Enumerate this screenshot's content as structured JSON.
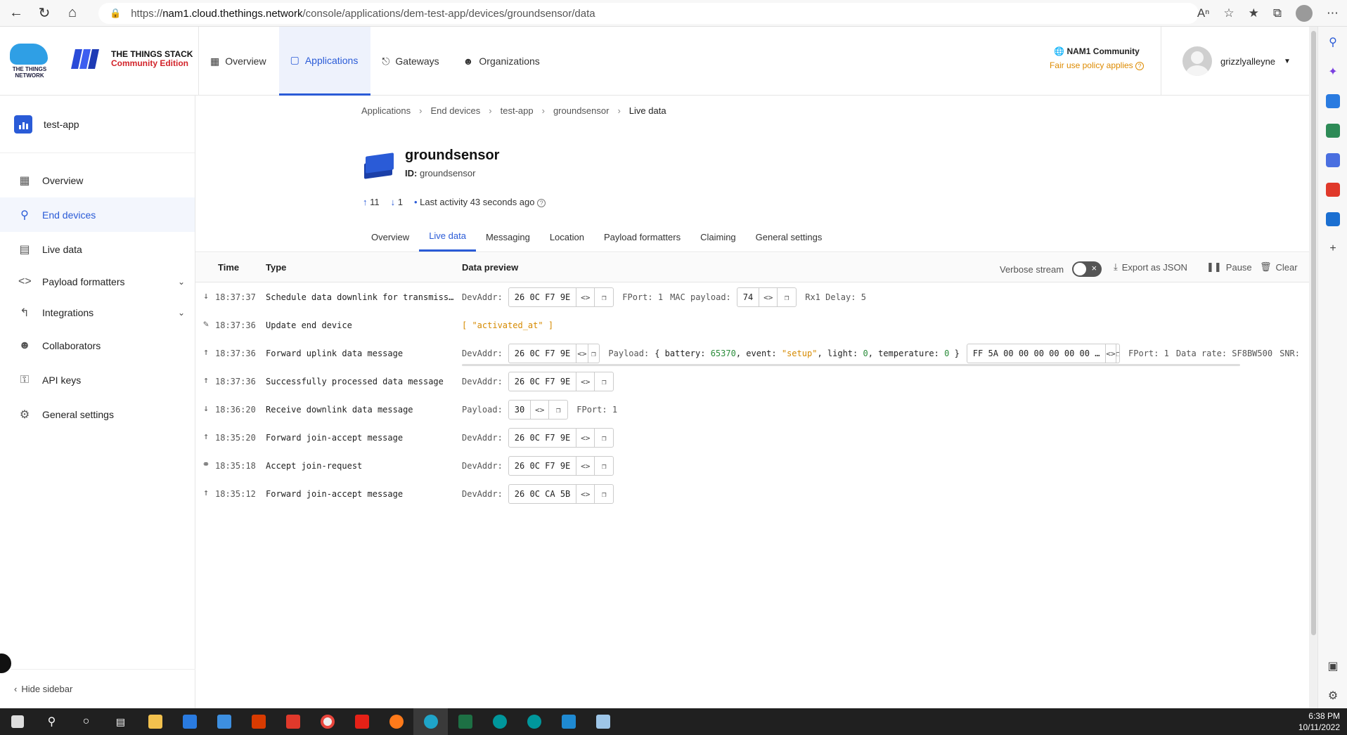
{
  "browser": {
    "url_prefix": "https://",
    "url_domain": "nam1.cloud.thethings.network",
    "url_path": "/console/applications/dem-test-app/devices/groundsensor/data"
  },
  "header": {
    "logo_text": "THE THINGS NETWORK",
    "stack_title": "THE THINGS STACK",
    "stack_edition": "Community Edition",
    "nav": [
      {
        "label": "Overview"
      },
      {
        "label": "Applications"
      },
      {
        "label": "Gateways"
      },
      {
        "label": "Organizations"
      }
    ],
    "cluster_name": "NAM1 Community",
    "cluster_note": "Fair use policy applies",
    "username": "grizzlyalleyne"
  },
  "sidebar": {
    "app_name": "test-app",
    "items": [
      {
        "label": "Overview"
      },
      {
        "label": "End devices"
      },
      {
        "label": "Live data"
      },
      {
        "label": "Payload formatters"
      },
      {
        "label": "Integrations"
      },
      {
        "label": "Collaborators"
      },
      {
        "label": "API keys"
      },
      {
        "label": "General settings"
      }
    ],
    "hide_label": "Hide sidebar"
  },
  "breadcrumb": [
    "Applications",
    "End devices",
    "test-app",
    "groundsensor",
    "Live data"
  ],
  "device": {
    "name": "groundsensor",
    "id_label": "ID:",
    "id_value": "groundsensor",
    "uplink_count": "11",
    "downlink_count": "1",
    "last_activity": "Last activity 43 seconds ago"
  },
  "tabs": [
    "Overview",
    "Live data",
    "Messaging",
    "Location",
    "Payload formatters",
    "Claiming",
    "General settings"
  ],
  "table": {
    "col_time": "Time",
    "col_type": "Type",
    "col_preview": "Data preview",
    "verbose_label": "Verbose stream",
    "export_label": "Export as JSON",
    "pause_label": "Pause",
    "clear_label": "Clear",
    "rows": [
      {
        "time": "18:37:37",
        "type": "Schedule data downlink for transmission",
        "devaddr": "26 0C F7 9E",
        "fport": "FPort: 1",
        "mac_label": "MAC payload:",
        "mac_value": "74",
        "rx1": "Rx1 Delay: 5"
      },
      {
        "time": "18:37:36",
        "type": "Update end device",
        "field": "[ \"activated_at\" ]"
      },
      {
        "time": "18:37:36",
        "type": "Forward uplink data message",
        "devaddr": "26 0C F7 9E",
        "payload_label": "Payload:",
        "pl_k1": "battery:",
        "pl_v1": "65370",
        "pl_k2": "event:",
        "pl_v2": "\"setup\"",
        "pl_k3": "light:",
        "pl_v3": "0",
        "pl_k4": "temperature:",
        "pl_v4": "0",
        "raw": "FF 5A 00 00 00 00 00 00 …",
        "fport": "FPort: 1",
        "datarate": "Data rate: SF8BW500",
        "snr": "SNR:"
      },
      {
        "time": "18:37:36",
        "type": "Successfully processed data message",
        "devaddr": "26 0C F7 9E"
      },
      {
        "time": "18:36:20",
        "type": "Receive downlink data message",
        "payload_label": "Payload:",
        "payload": "30",
        "fport": "FPort: 1"
      },
      {
        "time": "18:35:20",
        "type": "Forward join-accept message",
        "devaddr": "26 0C F7 9E"
      },
      {
        "time": "18:35:18",
        "type": "Accept join-request",
        "devaddr": "26 0C F7 9E"
      },
      {
        "time": "18:35:12",
        "type": "Forward join-accept message",
        "devaddr": "26 0C CA 5B"
      }
    ],
    "devaddr_label": "DevAddr:"
  },
  "taskbar": {
    "time": "6:38 PM",
    "date": "10/11/2022"
  },
  "colors": {
    "accent": "#2a5bd7",
    "warning": "#dd8a00",
    "number": "#2a8c3a",
    "string": "#d68a00"
  }
}
